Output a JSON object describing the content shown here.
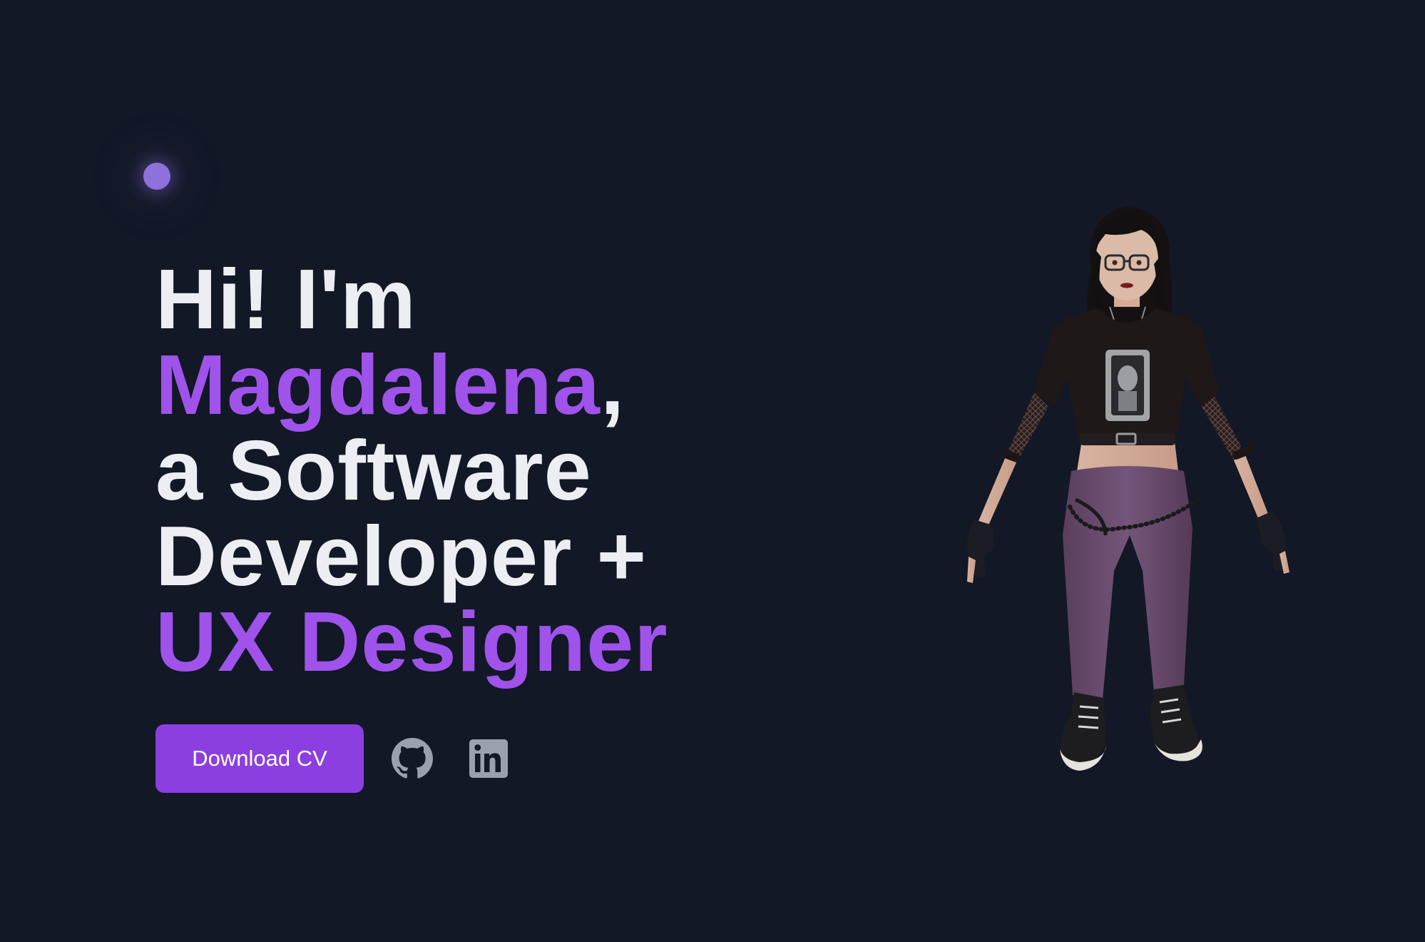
{
  "hero": {
    "greeting": "Hi! I'm",
    "name": "Magdalena",
    "name_suffix": ",",
    "role_prefix": "a Software",
    "role_line2": "Developer +",
    "role_highlight": "UX Designer"
  },
  "actions": {
    "download_label": "Download CV",
    "github_icon": "github-icon",
    "linkedin_icon": "linkedin-icon"
  },
  "avatar": {
    "icon": "3d-character-avatar"
  },
  "colors": {
    "background": "#121826",
    "accent": "#9f53ea",
    "button": "#8b3fe0",
    "text": "#eceef3",
    "icon": "#9aa1ad",
    "glow_dot": "#8f71dc"
  }
}
